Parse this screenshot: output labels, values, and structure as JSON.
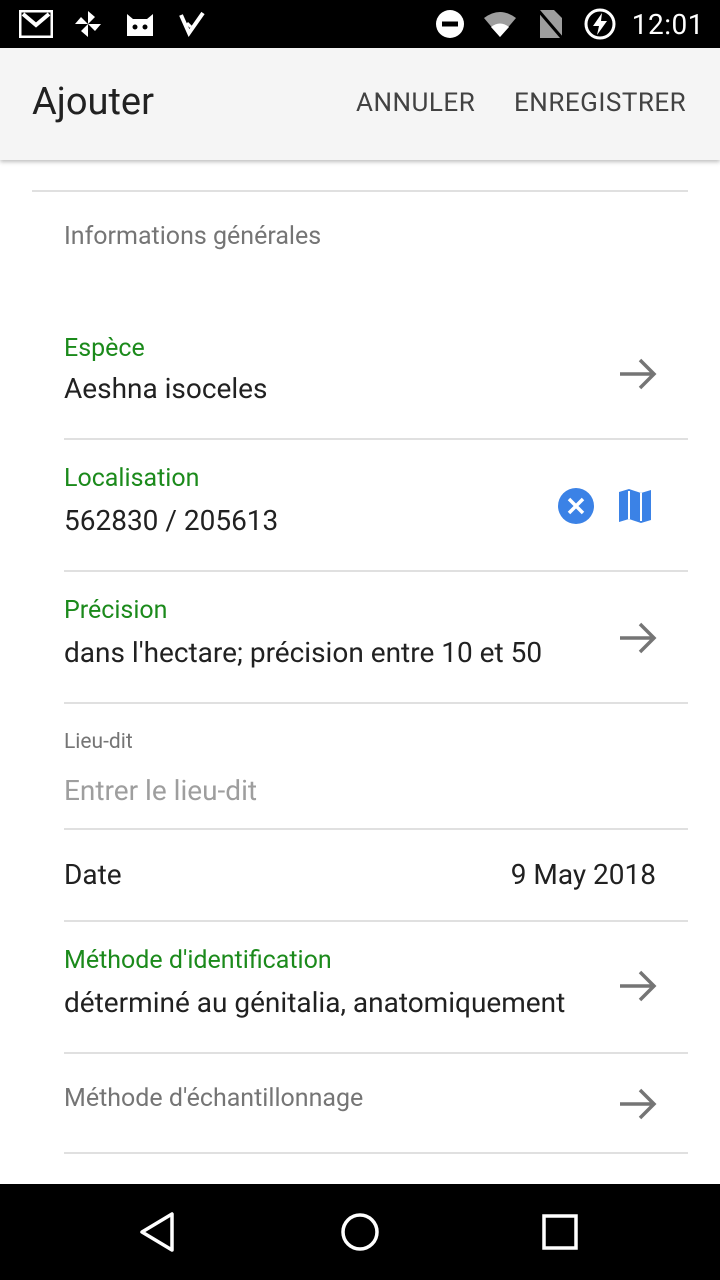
{
  "status_bar": {
    "time": "12:01",
    "left_icons": [
      "gmail-icon",
      "pinwheel-icon",
      "android-icon",
      "inbox-check-icon"
    ],
    "right_icons": [
      "do-not-disturb-icon",
      "wifi-icon",
      "no-sim-icon",
      "battery-charging-icon"
    ]
  },
  "app_bar": {
    "title": "Ajouter",
    "cancel_label": "ANNULER",
    "save_label": "ENREGISTRER"
  },
  "form": {
    "section_title": "Informations générales",
    "espece": {
      "label": "Espèce",
      "value": "Aeshna isoceles"
    },
    "localisation": {
      "label": "Localisation",
      "value": "562830 / 205613"
    },
    "precision": {
      "label": "Précision",
      "value": "dans l'hectare; précision entre 10 et 50"
    },
    "lieu_dit": {
      "label": "Lieu-dit",
      "placeholder": "Entrer le lieu-dit"
    },
    "date": {
      "label": "Date",
      "value": "9 May 2018"
    },
    "methode_identification": {
      "label": "Méthode d'identification",
      "value": "déterminé au génitalia, anatomiquement"
    },
    "methode_echantillonnage": {
      "label": "Méthode d'échantillonnage"
    }
  },
  "colors": {
    "accent_green": "#1b8a1b",
    "icon_blue": "#3b82e6"
  }
}
